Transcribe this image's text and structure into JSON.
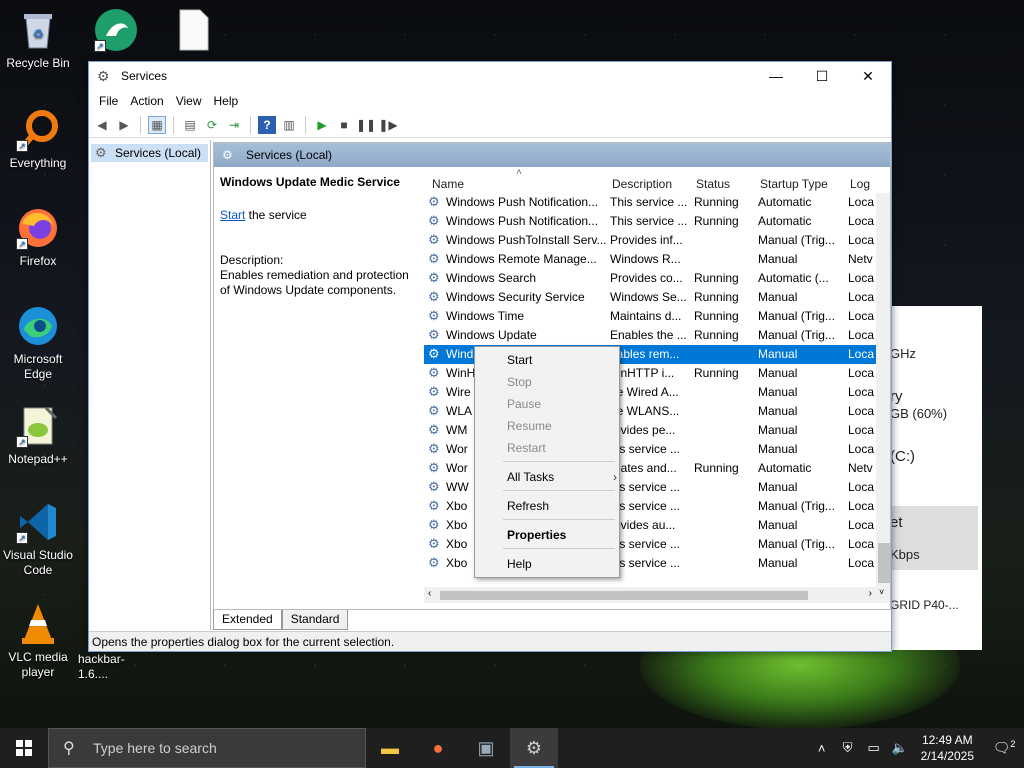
{
  "desktop": {
    "icons": [
      {
        "label": "Recycle Bin"
      },
      {
        "label": ""
      },
      {
        "label": ""
      },
      {
        "label": "Everything"
      },
      {
        "label": "Firefox"
      },
      {
        "label": "Microsoft Edge"
      },
      {
        "label": "Notepad++"
      },
      {
        "label": "Visual Studio Code"
      },
      {
        "label": "VLC media player"
      },
      {
        "label": "hackbar-1.6...."
      }
    ]
  },
  "bg_window": {
    "lines": [
      "GHz",
      "ry",
      "GB (60%)",
      "(C:)",
      "et",
      "Kbps",
      "GRID P40-..."
    ]
  },
  "window": {
    "title": "Services",
    "menu": [
      "File",
      "Action",
      "View",
      "Help"
    ],
    "tree_item": "Services (Local)",
    "pane_header": "Services (Local)",
    "desc": {
      "service_name": "Windows Update Medic Service",
      "start_link": "Start",
      "start_suffix": " the service",
      "label": "Description:",
      "text": "Enables remediation and protection of Windows Update components."
    },
    "columns": [
      "Name",
      "Description",
      "Status",
      "Startup Type",
      "Log"
    ],
    "rows": [
      [
        "Windows Push Notification...",
        "This service ...",
        "Running",
        "Automatic",
        "Loca"
      ],
      [
        "Windows Push Notification...",
        "This service ...",
        "Running",
        "Automatic",
        "Loca"
      ],
      [
        "Windows PushToInstall Serv...",
        "Provides inf...",
        "",
        "Manual (Trig...",
        "Loca"
      ],
      [
        "Windows Remote Manage...",
        "Windows R...",
        "",
        "Manual",
        "Netv"
      ],
      [
        "Windows Search",
        "Provides co...",
        "Running",
        "Automatic (...",
        "Loca"
      ],
      [
        "Windows Security Service",
        "Windows Se...",
        "Running",
        "Manual",
        "Loca"
      ],
      [
        "Windows Time",
        "Maintains d...",
        "Running",
        "Manual (Trig...",
        "Loca"
      ],
      [
        "Windows Update",
        "Enables the ...",
        "Running",
        "Manual (Trig...",
        "Loca"
      ],
      [
        "Windows Update Medic Ser...",
        "Enables rem...",
        "",
        "Manual",
        "Loca"
      ],
      [
        "WinHTTP Web Proxy Auto-...",
        "WinHTTP i...",
        "Running",
        "Manual",
        "Loca"
      ],
      [
        "Wired AutoConfig",
        "The Wired A...",
        "",
        "Manual",
        "Loca"
      ],
      [
        "WLAN AutoConfig",
        "The WLANS...",
        "",
        "Manual",
        "Loca"
      ],
      [
        "WMI Performance Adapter",
        "Provides pe...",
        "",
        "Manual",
        "Loca"
      ],
      [
        "Work Folders",
        "This service ...",
        "",
        "Manual",
        "Loca"
      ],
      [
        "Workstation",
        "Creates and...",
        "Running",
        "Automatic",
        "Netv"
      ],
      [
        "WWAN AutoConfig",
        "This service ...",
        "",
        "Manual",
        "Loca"
      ],
      [
        "Xbox Accessory Manage...",
        "This service ...",
        "",
        "Manual (Trig...",
        "Loca"
      ],
      [
        "Xbox Live Auth Manager",
        "Provides au...",
        "",
        "Manual",
        "Loca"
      ],
      [
        "Xbox Live Game Save",
        "This service ...",
        "",
        "Manual (Trig...",
        "Loca"
      ],
      [
        "Xbox Live Networking Se...",
        "This service ...",
        "",
        "Manual",
        "Loca"
      ]
    ],
    "visible_name_prefix": [
      "Windows Push Notification...",
      "Windows Push Notification...",
      "Windows PushToInstall Serv...",
      "Windows Remote Manage...",
      "Windows Search",
      "Windows Security Service",
      "Windows Time",
      "Windows Update",
      "Wind",
      "WinH",
      "Wire",
      "WLA",
      "WM",
      "Wor",
      "Wor",
      "WW",
      "Xbo",
      "Xbo",
      "Xbo",
      "Xbo"
    ],
    "visible_desc": [
      "This service ...",
      "This service ...",
      "Provides inf...",
      "Windows R...",
      "Provides co...",
      "Windows Se...",
      "Maintains d...",
      "Enables the ...",
      "Enables rem...",
      "WinHTTP i...",
      "The Wired A...",
      "The WLANS...",
      "Provides pe...",
      "This service ...",
      "Creates and...",
      "This service ...",
      "This service ...",
      "Provides au...",
      "This service ...",
      "This service ..."
    ],
    "visible_desc_clipped": [
      "This service ...",
      "This service ...",
      "Provides inf...",
      "Windows R...",
      "Provides co...",
      "Windows Se...",
      "Maintains d...",
      "Enables the ...",
      "nables rem...",
      "VinHTTP i...",
      "he Wired A...",
      "he WLANS...",
      "rovides pe...",
      "his service ...",
      "reates and...",
      "his service ...",
      "his service ...",
      "rovides au...",
      "his service ...",
      "his service ..."
    ],
    "selected_row": 8,
    "tabs": [
      "Extended",
      "Standard"
    ],
    "status": "Opens the properties dialog box for the current selection."
  },
  "context_menu": {
    "items": [
      "Start",
      "Stop",
      "Pause",
      "Resume",
      "Restart",
      "All Tasks",
      "Refresh",
      "Properties",
      "Help"
    ]
  },
  "taskbar": {
    "search_placeholder": "Type here to search",
    "time": "12:49 AM",
    "date": "2/14/2025",
    "notifications": "2"
  }
}
